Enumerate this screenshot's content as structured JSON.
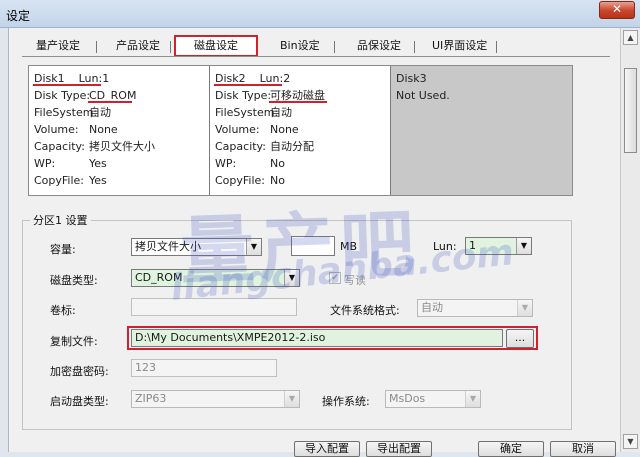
{
  "window": {
    "title": "设定",
    "close_glyph": "✕"
  },
  "tabs": [
    {
      "label": "量产设定"
    },
    {
      "label": "产品设定"
    },
    {
      "label": "磁盘设定",
      "active": true
    },
    {
      "label": "Bin设定"
    },
    {
      "label": "品保设定"
    },
    {
      "label": "UI界面设定"
    }
  ],
  "disks": [
    {
      "header": "Disk1    Lun:1",
      "rows": [
        {
          "key": "Disk Type:",
          "value": "CD_ROM"
        },
        {
          "key": "FileSystem:",
          "value": "自动"
        },
        {
          "key": "Volume:",
          "value": "None"
        },
        {
          "key": "Capacity:",
          "value": "拷贝文件大小"
        },
        {
          "key": "WP:",
          "value": "Yes"
        },
        {
          "key": "CopyFile:",
          "value": "Yes"
        }
      ]
    },
    {
      "header": "Disk2    Lun:2",
      "rows": [
        {
          "key": "Disk Type:",
          "value": "可移动磁盘"
        },
        {
          "key": "FileSystem:",
          "value": "自动"
        },
        {
          "key": "Volume:",
          "value": "None"
        },
        {
          "key": "Capacity:",
          "value": "自动分配"
        },
        {
          "key": "WP:",
          "value": "No"
        },
        {
          "key": "CopyFile:",
          "value": "No"
        }
      ]
    },
    {
      "header": "Disk3",
      "status": "Not Used."
    }
  ],
  "partition": {
    "group_label": "分区1 设置",
    "capacity": {
      "label": "容量:",
      "value": "拷贝文件大小",
      "size_value": "",
      "unit": "MB"
    },
    "lun": {
      "label": "Lun:",
      "value": "1"
    },
    "disk_type": {
      "label": "磁盘类型:",
      "value": "CD_ROM"
    },
    "write_protect": {
      "label": "写读",
      "checked": true
    },
    "volume_label": {
      "label": "卷标:",
      "value": ""
    },
    "fs_format": {
      "label": "文件系统格式:",
      "value": "自动"
    },
    "copy_file": {
      "label": "复制文件:",
      "value": "D:\\My Documents\\XMPE2012-2.iso",
      "browse_label": "..."
    },
    "encrypt_password": {
      "label": "加密盘密码:",
      "value": "123"
    },
    "boot_type": {
      "label": "启动盘类型:",
      "value": "ZIP63"
    },
    "os": {
      "label": "操作系统:",
      "value": "MsDos"
    }
  },
  "bottom_buttons": [
    {
      "label": "导入配置"
    },
    {
      "label": "导出配置"
    },
    {
      "label": "确定"
    },
    {
      "label": "取消"
    }
  ],
  "watermark": {
    "main": "量产吧",
    "sub": "liangchanba.com"
  },
  "colors": {
    "highlight_red": "#d0212f",
    "disk_title_blue": "#2a36c8",
    "field_green": "#dff3df"
  }
}
